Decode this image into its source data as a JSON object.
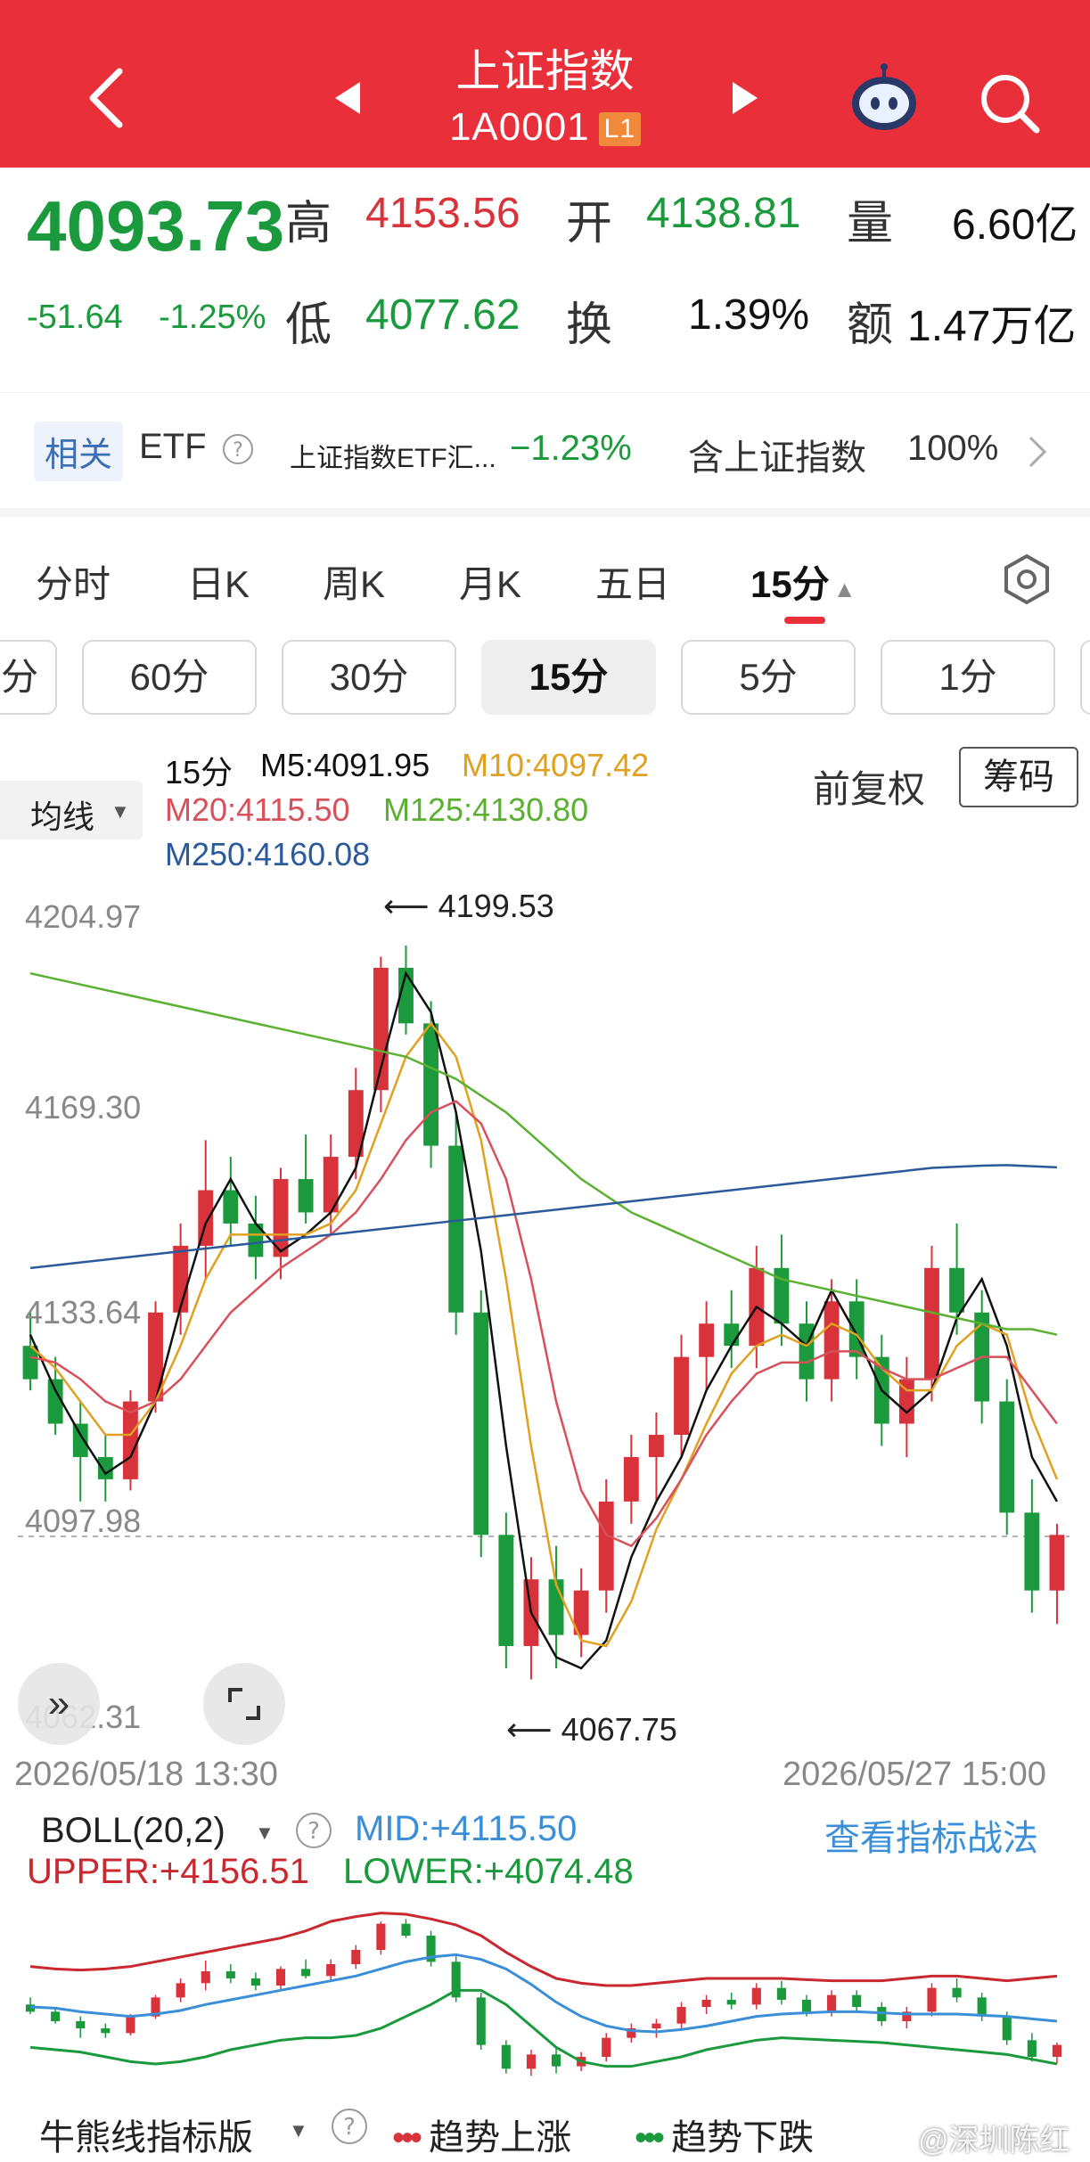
{
  "header": {
    "title": "上证指数",
    "code": "1A0001",
    "level_badge": "L1"
  },
  "quote": {
    "price": "4093.73",
    "change": "-51.64",
    "change_pct": "-1.25%",
    "high_label": "高",
    "high": "4153.56",
    "open_label": "开",
    "open": "4138.81",
    "volume_label": "量",
    "volume": "6.60亿",
    "low_label": "低",
    "low": "4077.62",
    "turnover_label": "换",
    "turnover": "1.39%",
    "amount_label": "额",
    "amount": "1.47万亿"
  },
  "etf_bar": {
    "tag": "相关",
    "type": "ETF",
    "fund_name": "上证指数ETF汇...",
    "fund_change": "−1.23%",
    "holding_text": "含上证指数",
    "holding_pct": "100%"
  },
  "tabs": [
    "分时",
    "日K",
    "周K",
    "月K",
    "五日",
    "15分"
  ],
  "active_tab": "15分",
  "period_pills": [
    "分",
    "60分",
    "30分",
    "15分",
    "5分",
    "1分"
  ],
  "active_pill": "15分",
  "ma_bar": {
    "selector": "均线",
    "period": "15分",
    "m5": "M5:4091.95",
    "m10": "M10:4097.42",
    "m20": "M20:4115.50",
    "m125": "M125:4130.80",
    "m250": "M250:4160.08",
    "fq": "前复权",
    "chouma": "筹码"
  },
  "colors": {
    "header": "#e9303a",
    "up": "#d8323a",
    "down": "#1a9a3c",
    "m5": "#111111",
    "m10": "#e0a020",
    "m20": "#d8505a",
    "m125": "#5ab030",
    "m250": "#2a5a9a"
  },
  "chart_data": {
    "type": "candlestick",
    "interval": "15分",
    "y_ticks": [
      "4204.97",
      "4169.30",
      "4133.64",
      "4097.98",
      "4062.31"
    ],
    "ylim": [
      4062.31,
      4204.97
    ],
    "max_label": "4199.53",
    "min_label": "4067.75",
    "reference_line": 4093.73,
    "x_start": "2026/05/18 13:30",
    "x_end": "2026/05/27 15:00",
    "series": [
      {
        "name": "M5",
        "values": [
          4130,
          4120,
          4112,
          4105,
          4108,
          4118,
          4135,
          4150,
          4158,
          4150,
          4145,
          4148,
          4152,
          4160,
          4178,
          4195,
          4188,
          4170,
          4145,
          4110,
          4080,
          4072,
          4070,
          4075,
          4090,
          4100,
          4108,
          4120,
          4128,
          4135,
          4132,
          4128,
          4138,
          4130,
          4120,
          4116,
          4120,
          4133,
          4140,
          4128,
          4108,
          4100
        ]
      },
      {
        "name": "M10",
        "values": [
          4128,
          4124,
          4118,
          4112,
          4112,
          4118,
          4128,
          4140,
          4148,
          4148,
          4148,
          4148,
          4150,
          4156,
          4168,
          4180,
          4186,
          4180,
          4165,
          4140,
          4110,
          4085,
          4075,
          4074,
          4082,
          4095,
          4104,
          4114,
          4123,
          4128,
          4130,
          4128,
          4132,
          4130,
          4124,
          4120,
          4120,
          4128,
          4132,
          4130,
          4115,
          4104
        ]
      },
      {
        "name": "M20",
        "values": [
          4126,
          4125,
          4122,
          4118,
          4116,
          4118,
          4122,
          4128,
          4134,
          4138,
          4142,
          4145,
          4148,
          4152,
          4158,
          4165,
          4170,
          4172,
          4168,
          4158,
          4140,
          4118,
          4102,
          4094,
          4092,
          4097,
          4104,
          4112,
          4118,
          4123,
          4125,
          4125,
          4127,
          4127,
          4124,
          4122,
          4122,
          4124,
          4126,
          4126,
          4120,
          4114
        ]
      },
      {
        "name": "M125",
        "values": [
          4195,
          4194,
          4193,
          4192,
          4191,
          4190,
          4189,
          4188,
          4187,
          4186,
          4185,
          4184,
          4183,
          4182,
          4181,
          4180,
          4178,
          4176,
          4173,
          4170,
          4166,
          4162,
          4158,
          4155,
          4152,
          4150,
          4148,
          4146,
          4144,
          4142,
          4140,
          4139,
          4138,
          4137,
          4136,
          4135,
          4134,
          4133,
          4132,
          4131,
          4131,
          4130
        ]
      },
      {
        "name": "M250",
        "values": [
          4142,
          4142.5,
          4143,
          4143.5,
          4144,
          4144.5,
          4145,
          4145.5,
          4146,
          4146.5,
          4147,
          4147.5,
          4148,
          4148.5,
          4149,
          4149.5,
          4150,
          4150.5,
          4151,
          4151.5,
          4152,
          4152.5,
          4153,
          4153.5,
          4154,
          4154.5,
          4155,
          4155.5,
          4156,
          4156.5,
          4157,
          4157.5,
          4158,
          4158.5,
          4159,
          4159.5,
          4160,
          4160.2,
          4160.4,
          4160.5,
          4160.3,
          4160.1
        ]
      }
    ],
    "candles": [
      [
        4128,
        4134,
        4120,
        4122
      ],
      [
        4122,
        4126,
        4112,
        4114
      ],
      [
        4114,
        4118,
        4100,
        4108
      ],
      [
        4108,
        4112,
        4100,
        4104
      ],
      [
        4104,
        4120,
        4102,
        4118
      ],
      [
        4118,
        4136,
        4116,
        4134
      ],
      [
        4134,
        4150,
        4130,
        4146
      ],
      [
        4146,
        4165,
        4140,
        4156
      ],
      [
        4156,
        4162,
        4146,
        4150
      ],
      [
        4150,
        4155,
        4140,
        4144
      ],
      [
        4144,
        4160,
        4140,
        4158
      ],
      [
        4158,
        4166,
        4150,
        4152
      ],
      [
        4152,
        4166,
        4148,
        4162
      ],
      [
        4162,
        4178,
        4158,
        4174
      ],
      [
        4174,
        4198,
        4170,
        4196
      ],
      [
        4196,
        4200,
        4184,
        4186
      ],
      [
        4186,
        4190,
        4160,
        4164
      ],
      [
        4164,
        4170,
        4130,
        4134
      ],
      [
        4134,
        4138,
        4090,
        4094
      ],
      [
        4094,
        4098,
        4070,
        4074
      ],
      [
        4074,
        4090,
        4068,
        4086
      ],
      [
        4086,
        4092,
        4070,
        4076
      ],
      [
        4076,
        4088,
        4072,
        4084
      ],
      [
        4084,
        4104,
        4080,
        4100
      ],
      [
        4100,
        4112,
        4096,
        4108
      ],
      [
        4108,
        4116,
        4100,
        4112
      ],
      [
        4112,
        4130,
        4108,
        4126
      ],
      [
        4126,
        4136,
        4120,
        4132
      ],
      [
        4132,
        4138,
        4124,
        4128
      ],
      [
        4128,
        4146,
        4124,
        4142
      ],
      [
        4142,
        4148,
        4128,
        4132
      ],
      [
        4132,
        4136,
        4118,
        4122
      ],
      [
        4122,
        4140,
        4118,
        4136
      ],
      [
        4136,
        4140,
        4122,
        4126
      ],
      [
        4126,
        4130,
        4110,
        4114
      ],
      [
        4114,
        4126,
        4108,
        4122
      ],
      [
        4122,
        4146,
        4118,
        4142
      ],
      [
        4142,
        4150,
        4130,
        4134
      ],
      [
        4134,
        4138,
        4114,
        4118
      ],
      [
        4118,
        4122,
        4094,
        4098
      ],
      [
        4098,
        4104,
        4080,
        4084
      ],
      [
        4084,
        4096,
        4078,
        4094
      ]
    ]
  },
  "boll": {
    "label": "BOLL(20,2)",
    "mid": "MID:+4115.50",
    "upper": "UPPER:+4156.51",
    "lower": "LOWER:+4074.48",
    "link": "查看指标战法",
    "upper_values": [
      4160,
      4158,
      4157,
      4158,
      4160,
      4164,
      4168,
      4172,
      4176,
      4180,
      4184,
      4190,
      4198,
      4202,
      4205,
      4204,
      4200,
      4195,
      4186,
      4172,
      4160,
      4150,
      4146,
      4144,
      4144,
      4146,
      4148,
      4150,
      4150,
      4150,
      4150,
      4149,
      4148,
      4148,
      4148,
      4150,
      4152,
      4152,
      4150,
      4148,
      4150,
      4152
    ],
    "mid_values": [
      4126,
      4125,
      4122,
      4120,
      4118,
      4120,
      4123,
      4128,
      4132,
      4136,
      4140,
      4144,
      4148,
      4152,
      4158,
      4164,
      4168,
      4170,
      4166,
      4158,
      4145,
      4130,
      4118,
      4110,
      4106,
      4105,
      4107,
      4110,
      4114,
      4118,
      4120,
      4121,
      4122,
      4122,
      4121,
      4120,
      4120,
      4120,
      4119,
      4118,
      4116,
      4114
    ],
    "lower_values": [
      4092,
      4090,
      4088,
      4084,
      4080,
      4078,
      4080,
      4084,
      4090,
      4094,
      4098,
      4100,
      4100,
      4102,
      4108,
      4118,
      4128,
      4140,
      4140,
      4128,
      4110,
      4092,
      4080,
      4076,
      4076,
      4080,
      4084,
      4090,
      4094,
      4098,
      4100,
      4099,
      4098,
      4097,
      4096,
      4094,
      4092,
      4090,
      4088,
      4086,
      4082,
      4078
    ]
  },
  "bull_bear": {
    "label": "牛熊线指标版",
    "up_legend": "趋势上涨",
    "down_legend": "趋势下跌"
  },
  "watermark": "@深圳陈红"
}
